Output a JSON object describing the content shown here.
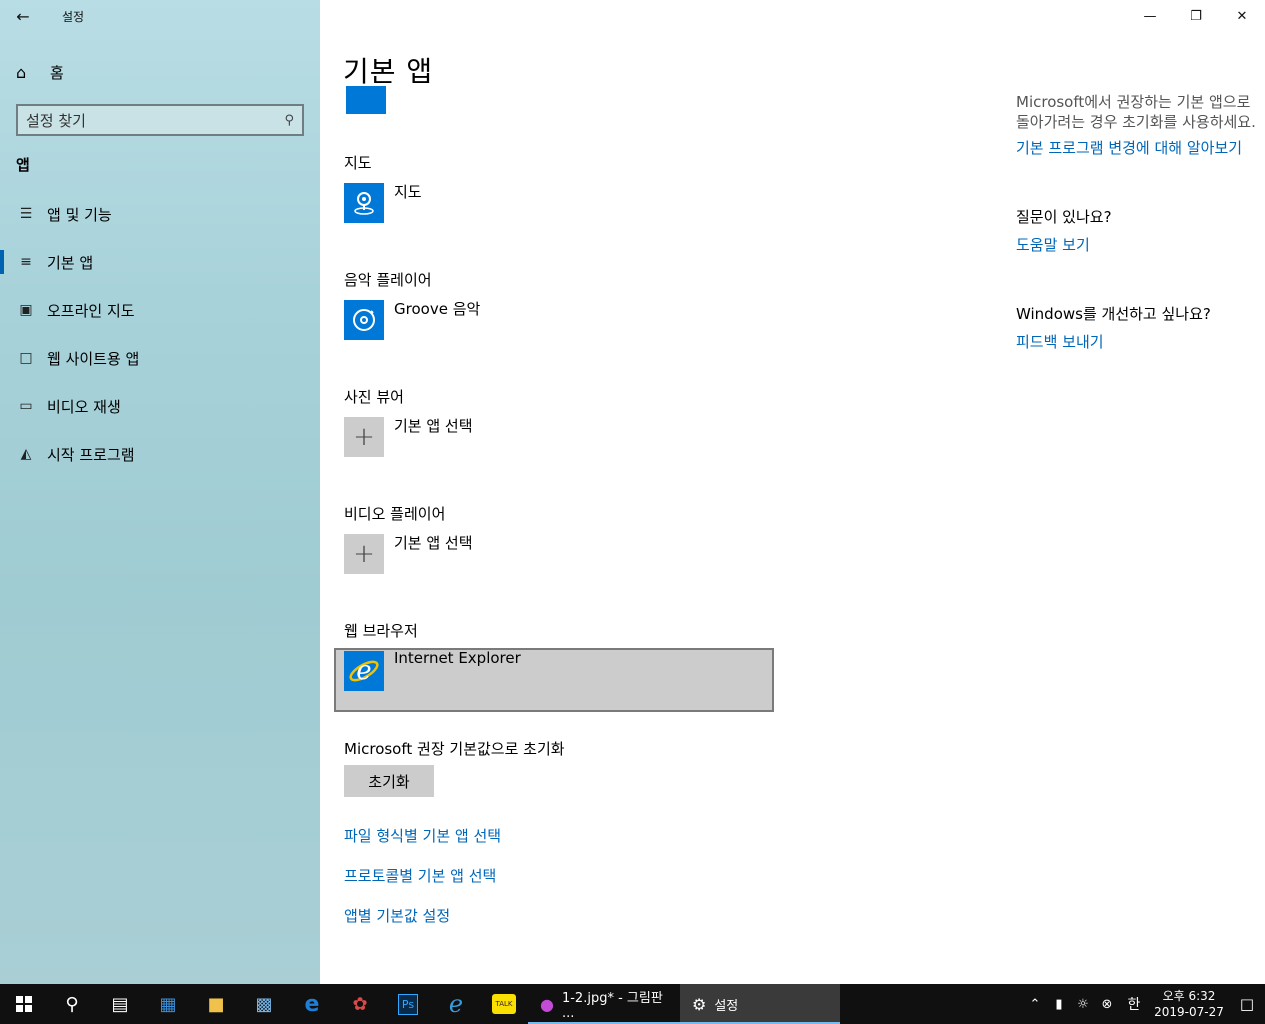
{
  "window": {
    "title": "설정"
  },
  "sidebar": {
    "home_label": "홈",
    "search_placeholder": "설정 찾기",
    "section": "앱",
    "items": [
      {
        "label": "앱 및 기능",
        "icon": "apps-features-icon"
      },
      {
        "label": "기본 앱",
        "icon": "default-apps-icon",
        "active": true
      },
      {
        "label": "오프라인 지도",
        "icon": "offline-maps-icon"
      },
      {
        "label": "웹 사이트용 앱",
        "icon": "apps-for-websites-icon"
      },
      {
        "label": "비디오 재생",
        "icon": "video-playback-icon"
      },
      {
        "label": "시작 프로그램",
        "icon": "startup-icon"
      }
    ]
  },
  "main": {
    "title": "기본 앱",
    "groups": [
      {
        "label": "지도",
        "app": "지도"
      },
      {
        "label": "음악 플레이어",
        "app": "Groove 음악"
      },
      {
        "label": "사진 뷰어",
        "app": "기본 앱 선택"
      },
      {
        "label": "비디오 플레이어",
        "app": "기본 앱 선택"
      },
      {
        "label": "웹 브라우저",
        "app": "Internet Explorer"
      }
    ],
    "reset_label": "Microsoft 권장 기본값으로 초기화",
    "reset_button": "초기화",
    "links": [
      "파일 형식별 기본 앱 선택",
      "프로토콜별 기본 앱 선택",
      "앱별 기본값 설정"
    ]
  },
  "right": {
    "desc": "Microsoft에서 권장하는 기본 앱으로 돌아가려는 경우 초기화를 사용하세요.",
    "learn_link": "기본 프로그램 변경에 대해 알아보기",
    "question": "질문이 있나요?",
    "help_link": "도움말 보기",
    "improve": "Windows를 개선하고 싶나요?",
    "feedback_link": "피드백 보내기"
  },
  "taskbar": {
    "paint_label": "1-2.jpg* - 그림판 ...",
    "settings_label": "설정",
    "ime": "한",
    "time": "오후 6:32",
    "date": "2019-07-27"
  }
}
